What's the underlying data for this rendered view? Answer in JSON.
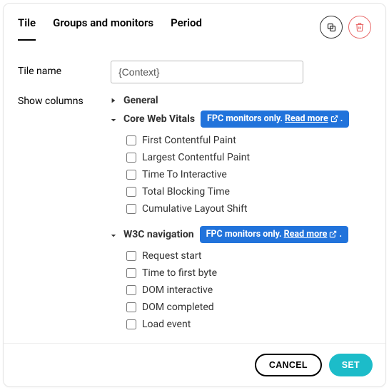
{
  "tabs": {
    "tile": "Tile",
    "groups": "Groups and monitors",
    "period": "Period"
  },
  "labels": {
    "tile_name": "Tile name",
    "show_columns": "Show columns"
  },
  "fields": {
    "tile_name_value": "{Context}"
  },
  "groups": {
    "general": {
      "title": "General"
    },
    "cwv": {
      "title": "Core Web Vitals",
      "badge_text": "FPC monitors only.",
      "badge_link": "Read more",
      "items": [
        "First Contentful Paint",
        "Largest Contentful Paint",
        "Time To Interactive",
        "Total Blocking Time",
        "Cumulative Layout Shift"
      ]
    },
    "w3c": {
      "title": "W3C navigation",
      "badge_text": "FPC monitors only.",
      "badge_link": "Read more",
      "items": [
        "Request start",
        "Time to first byte",
        "DOM interactive",
        "DOM completed",
        "Load event"
      ]
    }
  },
  "footer": {
    "cancel": "CANCEL",
    "set": "SET"
  }
}
